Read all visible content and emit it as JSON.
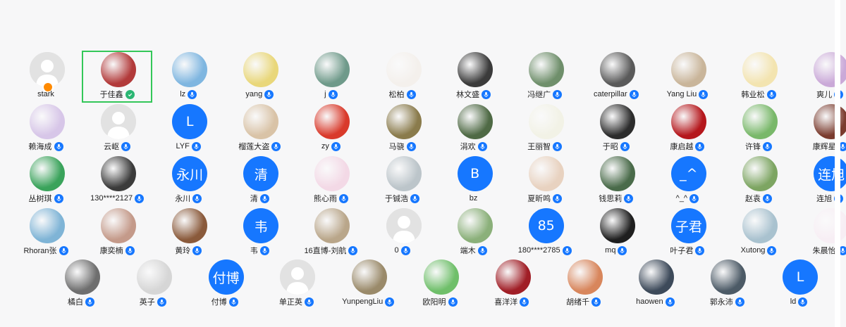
{
  "colors": {
    "accent": "#1677ff",
    "selected_border": "#34c759",
    "badge_green": "#2bb673",
    "status_orange": "#ff8a00"
  },
  "participants": [
    {
      "name": "stark",
      "avatar": "default",
      "badge": "none",
      "status": "away"
    },
    {
      "name": "于佳鑫",
      "avatar": "photo",
      "color": "#b23a3a",
      "badge": "green",
      "selected": true
    },
    {
      "name": "lz",
      "avatar": "photo",
      "color": "#7fb6e0",
      "badge": "mic"
    },
    {
      "name": "yang",
      "avatar": "photo",
      "color": "#e9d77a",
      "badge": "mic"
    },
    {
      "name": "j",
      "avatar": "photo",
      "color": "#6f9a8a",
      "badge": "mic"
    },
    {
      "name": "松柏",
      "avatar": "photo",
      "color": "#f4f0ec",
      "badge": "mic"
    },
    {
      "name": "林文盛",
      "avatar": "photo",
      "color": "#3b3b3b",
      "badge": "mic"
    },
    {
      "name": "冯继广",
      "avatar": "photo",
      "color": "#6f8f6b",
      "badge": "mic"
    },
    {
      "name": "caterpillar",
      "avatar": "photo",
      "color": "#5a5a5a",
      "badge": "mic"
    },
    {
      "name": "Yang Liu",
      "avatar": "photo",
      "color": "#c9b59a",
      "badge": "mic"
    },
    {
      "name": "韩业松",
      "avatar": "photo",
      "color": "#f3e4b0",
      "badge": "mic"
    },
    {
      "name": "爽儿",
      "avatar": "photo",
      "color": "#caa9d8",
      "badge": "mic"
    },
    {
      "name": "赖海成",
      "avatar": "photo",
      "color": "#d7c6e8",
      "badge": "mic"
    },
    {
      "name": "云岖",
      "avatar": "default",
      "badge": "mic"
    },
    {
      "name": "LYF",
      "avatar": "text",
      "initials": "L",
      "badge": "mic"
    },
    {
      "name": "榴莲大盗",
      "avatar": "photo",
      "color": "#d9c3a7",
      "badge": "mic"
    },
    {
      "name": "zy",
      "avatar": "photo",
      "color": "#d93a2b",
      "badge": "mic"
    },
    {
      "name": "马骁",
      "avatar": "photo",
      "color": "#8a7b4c",
      "badge": "mic"
    },
    {
      "name": "涓欢",
      "avatar": "photo",
      "color": "#4f6a45",
      "badge": "mic"
    },
    {
      "name": "王丽智",
      "avatar": "photo",
      "color": "#f2f2e6",
      "badge": "mic"
    },
    {
      "name": "于昭",
      "avatar": "photo",
      "color": "#2c2c2c",
      "badge": "mic"
    },
    {
      "name": "康启越",
      "avatar": "photo",
      "color": "#b5171c",
      "badge": "mic"
    },
    {
      "name": "许锋",
      "avatar": "photo",
      "color": "#79b86a",
      "badge": "mic"
    },
    {
      "name": "康辉星",
      "avatar": "photo",
      "color": "#7a3b2e",
      "badge": "mic"
    },
    {
      "name": "丛树琪",
      "avatar": "photo",
      "color": "#3aa35b",
      "badge": "mic"
    },
    {
      "name": "130****2127",
      "avatar": "photo",
      "color": "#3b3b3b",
      "badge": "mic"
    },
    {
      "name": "永川",
      "avatar": "text",
      "initials": "永川",
      "badge": "mic"
    },
    {
      "name": "清",
      "avatar": "text",
      "initials": "清",
      "badge": "mic"
    },
    {
      "name": "熊心雨",
      "avatar": "photo",
      "color": "#f3d9e6",
      "badge": "mic"
    },
    {
      "name": "于铖浩",
      "avatar": "photo",
      "color": "#bcc5ca",
      "badge": "mic"
    },
    {
      "name": "bz",
      "avatar": "text",
      "initials": "B",
      "badge": "none"
    },
    {
      "name": "夏昕鸣",
      "avatar": "photo",
      "color": "#e8d2c0",
      "badge": "mic"
    },
    {
      "name": "钱思莉",
      "avatar": "photo",
      "color": "#4a6b4a",
      "badge": "mic"
    },
    {
      "name": "^_^",
      "avatar": "text",
      "initials": "_^",
      "badge": "mic"
    },
    {
      "name": "赵袁",
      "avatar": "photo",
      "color": "#7da562",
      "badge": "mic",
      "status": "red"
    },
    {
      "name": "连旭",
      "avatar": "text",
      "initials": "连旭",
      "badge": "mic"
    },
    {
      "name": "Rhoran张",
      "avatar": "photo",
      "color": "#7fb4d6",
      "badge": "mic"
    },
    {
      "name": "康奕楠",
      "avatar": "photo",
      "color": "#c49a8a",
      "badge": "mic"
    },
    {
      "name": "黄玲",
      "avatar": "photo",
      "color": "#8a5a3b",
      "badge": "mic"
    },
    {
      "name": "韦",
      "avatar": "text",
      "initials": "韦",
      "badge": "mic"
    },
    {
      "name": "16直博-刘航",
      "avatar": "photo",
      "color": "#b9a68a",
      "badge": "mic"
    },
    {
      "name": "0",
      "avatar": "default",
      "badge": "mic"
    },
    {
      "name": "端木",
      "avatar": "photo",
      "color": "#8bb07a",
      "badge": "mic"
    },
    {
      "name": "180****2785",
      "avatar": "text",
      "initials": "85",
      "badge": "mic"
    },
    {
      "name": "mq",
      "avatar": "photo",
      "color": "#1f1f1f",
      "badge": "mic"
    },
    {
      "name": "叶子君",
      "avatar": "text",
      "initials": "子君",
      "badge": "mic"
    },
    {
      "name": "Xutong",
      "avatar": "photo",
      "color": "#a9c2cf",
      "badge": "mic"
    },
    {
      "name": "朱晨怡",
      "avatar": "photo",
      "color": "#f7eef4",
      "badge": "mic"
    },
    {
      "name": "橘白",
      "avatar": "photo",
      "color": "#6e6e6e",
      "badge": "mic"
    },
    {
      "name": "英子",
      "avatar": "photo",
      "color": "#d6d6d6",
      "badge": "mic"
    },
    {
      "name": "付博",
      "avatar": "text",
      "initials": "付博",
      "badge": "mic"
    },
    {
      "name": "单正英",
      "avatar": "default",
      "badge": "mic"
    },
    {
      "name": "YunpengLiu",
      "avatar": "photo",
      "color": "#9a8a6a",
      "badge": "mic"
    },
    {
      "name": "欧阳明",
      "avatar": "photo",
      "color": "#6fbf6a",
      "badge": "mic"
    },
    {
      "name": "喜洋洋",
      "avatar": "photo",
      "color": "#a01e26",
      "badge": "mic"
    },
    {
      "name": "胡绪千",
      "avatar": "photo",
      "color": "#d8865c",
      "badge": "mic"
    },
    {
      "name": "haowen",
      "avatar": "photo",
      "color": "#3d4a5a",
      "badge": "mic"
    },
    {
      "name": "郭永沛",
      "avatar": "photo",
      "color": "#4c5a66",
      "badge": "mic"
    },
    {
      "name": "ld",
      "avatar": "text",
      "initials": "L",
      "badge": "mic"
    }
  ]
}
